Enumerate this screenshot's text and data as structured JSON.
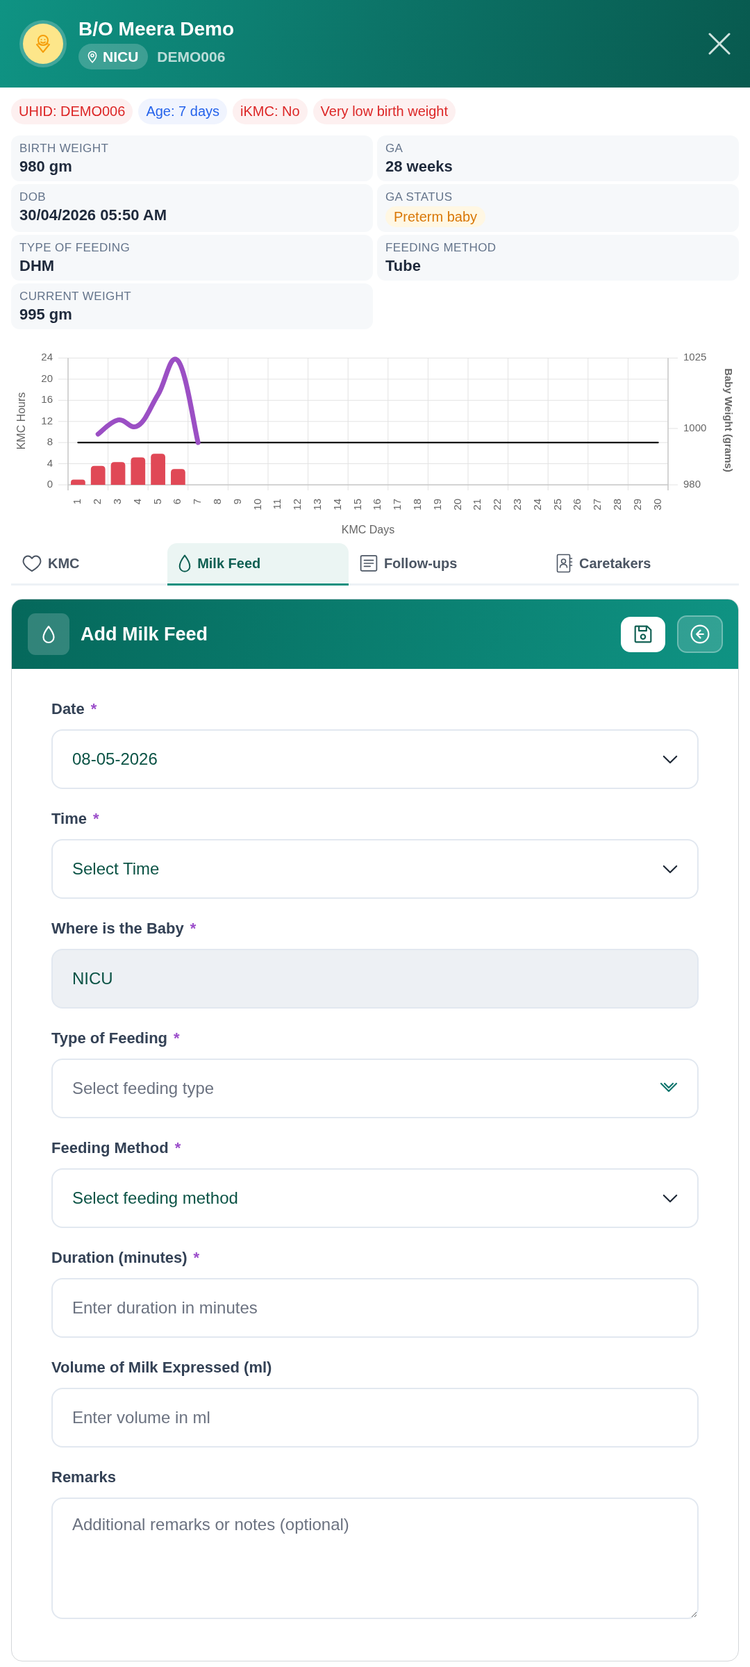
{
  "header": {
    "name": "B/O Meera Demo",
    "location": "NICU",
    "patient_id": "DEMO006"
  },
  "tags": [
    {
      "text": "UHID: DEMO006",
      "color": "#dc2626"
    },
    {
      "text": "Age: 7 days",
      "color": "#2563eb"
    },
    {
      "text": "iKMC: No",
      "color": "#dc2626"
    },
    {
      "text": "Very low birth weight",
      "color": "#dc2626"
    }
  ],
  "details": [
    {
      "label": "BIRTH WEIGHT",
      "value": "980 gm",
      "kind": "text"
    },
    {
      "label": "GA",
      "value": "28 weeks",
      "kind": "text"
    },
    {
      "label": "DOB",
      "value": "30/04/2026 05:50 AM",
      "kind": "text"
    },
    {
      "label": "GA STATUS",
      "value": "Preterm baby",
      "kind": "badge"
    },
    {
      "label": "TYPE OF FEEDING",
      "value": "DHM",
      "kind": "text"
    },
    {
      "label": "FEEDING METHOD",
      "value": "Tube",
      "kind": "text"
    },
    {
      "label": "CURRENT WEIGHT",
      "value": "995 gm",
      "kind": "text"
    }
  ],
  "chart": {
    "chart_data": {
      "type": "bar",
      "xlabel": "KMC Days",
      "ylabel": "KMC Hours",
      "y2label": "Baby Weight (grams)",
      "grid": true,
      "categories": [
        "1",
        "2",
        "3",
        "4",
        "5",
        "6",
        "7",
        "8",
        "9",
        "10",
        "11",
        "12",
        "13",
        "14",
        "15",
        "16",
        "17",
        "18",
        "19",
        "20",
        "21",
        "22",
        "23",
        "24",
        "25",
        "26",
        "27",
        "28",
        "29",
        "30"
      ],
      "series": [
        {
          "type": "bar",
          "axis": "y",
          "color": "#e04856",
          "values": [
            1,
            3.6,
            4.3,
            5.2,
            5.9,
            3,
            null,
            null,
            null,
            null,
            null,
            null,
            null,
            null,
            null,
            null,
            null,
            null,
            null,
            null,
            null,
            null,
            null,
            null,
            null,
            null,
            null,
            null,
            null,
            null
          ]
        },
        {
          "type": "line",
          "axis": "y",
          "color": "#000000",
          "values": [
            8,
            8,
            8,
            8,
            8,
            8,
            8,
            8,
            8,
            8,
            8,
            8,
            8,
            8,
            8,
            8,
            8,
            8,
            8,
            8,
            8,
            8,
            8,
            8,
            8,
            8,
            8,
            8,
            8,
            8
          ]
        },
        {
          "type": "line",
          "axis": "y2",
          "color": "#9b4fc4",
          "values": [
            null,
            998,
            1003,
            1001,
            1012,
            1024,
            995,
            null,
            null,
            null,
            null,
            null,
            null,
            null,
            null,
            null,
            null,
            null,
            null,
            null,
            null,
            null,
            null,
            null,
            null,
            null,
            null,
            null,
            null,
            null
          ]
        }
      ],
      "ylim": [
        0,
        24
      ],
      "yticks": [
        0,
        4,
        8,
        12,
        16,
        20,
        24
      ],
      "y2lim": [
        980,
        1025
      ],
      "y2ticks": [
        980,
        1000,
        1025
      ]
    }
  },
  "tabs": [
    {
      "label": "KMC",
      "selected": false
    },
    {
      "label": "Milk Feed",
      "selected": true
    },
    {
      "label": "Follow-ups",
      "selected": false
    },
    {
      "label": "Caretakers",
      "selected": false
    }
  ],
  "form": {
    "title": "Add Milk Feed",
    "fields": [
      {
        "label": "Date",
        "required_mark": "*",
        "kind": "select",
        "value": "08-05-2026",
        "disabled": false
      },
      {
        "label": "Time",
        "required_mark": "*",
        "kind": "select",
        "value": "Select Time",
        "disabled": false
      },
      {
        "label": "Where is the Baby",
        "required_mark": "*",
        "kind": "input",
        "value": "NICU",
        "disabled": true
      },
      {
        "label": "Type of Feeding",
        "required_mark": "*",
        "kind": "combobox",
        "placeholder": "Select feeding type",
        "disabled": false
      },
      {
        "label": "Feeding Method",
        "required_mark": "*",
        "kind": "select",
        "value": "Select feeding method",
        "disabled": false
      },
      {
        "label": "Duration (minutes)",
        "required_mark": "*",
        "kind": "input",
        "placeholder": "Enter duration in minutes",
        "disabled": false
      },
      {
        "label": "Volume of Milk Expressed (ml)",
        "kind": "input",
        "placeholder": "Enter volume in ml",
        "disabled": false
      },
      {
        "label": "Remarks",
        "kind": "textarea",
        "placeholder": "Additional remarks or notes (optional)",
        "disabled": false
      }
    ]
  }
}
